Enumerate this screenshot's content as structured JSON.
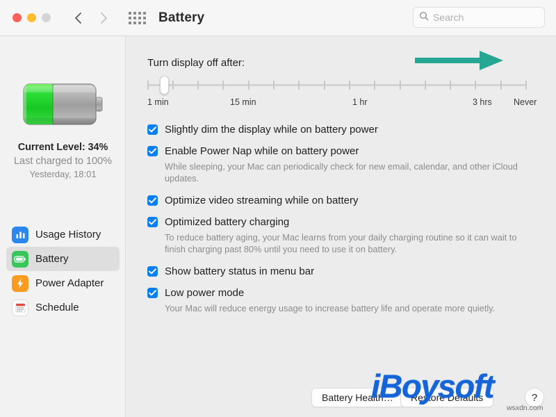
{
  "window": {
    "title": "Battery",
    "traffic_lights": [
      "close",
      "minimize",
      "zoom"
    ],
    "back_label": "Back",
    "forward_label": "Forward",
    "grid_label": "Show All Preferences"
  },
  "search": {
    "placeholder": "Search",
    "value": "",
    "icon": "search-icon"
  },
  "sidebar": {
    "battery_icon": "battery-level-icon",
    "battery_fill_percent": 34,
    "current_level": "Current Level: 34%",
    "last_charged": "Last charged to 100%",
    "charged_time": "Yesterday, 18:01",
    "items": [
      {
        "label": "Usage History",
        "icon": "bar-chart-icon",
        "selected": false,
        "icon_color": "#2b86f0"
      },
      {
        "label": "Battery",
        "icon": "battery-icon",
        "selected": true,
        "icon_color": "#39c75b"
      },
      {
        "label": "Power Adapter",
        "icon": "lightning-bolt-icon",
        "selected": false,
        "icon_color": "#f99b20"
      },
      {
        "label": "Schedule",
        "icon": "calendar-icon",
        "selected": false,
        "icon_color": "#fbfbfb"
      }
    ]
  },
  "main": {
    "slider": {
      "label": "Turn display off after:",
      "tick_count": 16,
      "thumb_position_index": 0,
      "scale_labels": [
        {
          "text": "1 min",
          "left_pct": 0
        },
        {
          "text": "15 min",
          "left_pct": 22
        },
        {
          "text": "1 hr",
          "left_pct": 54
        },
        {
          "text": "3 hrs",
          "left_pct": 86
        },
        {
          "text": "Never",
          "left_pct": 97
        }
      ]
    },
    "annotation_arrow": {
      "name": "green-arrow-annotation",
      "color": "#26a793",
      "direction": "right"
    },
    "options": [
      {
        "label": "Slightly dim the display while on battery power",
        "checked": true,
        "description": ""
      },
      {
        "label": "Enable Power Nap while on battery power",
        "checked": true,
        "description": "While sleeping, your Mac can periodically check for new email, calendar, and other iCloud updates."
      },
      {
        "label": "Optimize video streaming while on battery",
        "checked": true,
        "description": ""
      },
      {
        "label": "Optimized battery charging",
        "checked": true,
        "description": "To reduce battery aging, your Mac learns from your daily charging routine so it can wait to finish charging past 80% until you need to use it on battery."
      },
      {
        "label": "Show battery status in menu bar",
        "checked": true,
        "description": ""
      },
      {
        "label": "Low power mode",
        "checked": true,
        "description": "Your Mac will reduce energy usage to increase battery life and operate more quietly."
      }
    ],
    "buttons": {
      "battery_health": "Battery Health…",
      "restore_defaults": "Restore Defaults",
      "help": "?"
    }
  },
  "watermarks": {
    "logo": "iBoysoft",
    "url": "wsxdn.com"
  },
  "colors": {
    "accent_blue": "#0a7ff2",
    "annotation_green": "#26a793",
    "battery_green": "#2fd644",
    "watermark_blue": "#1565d8"
  }
}
